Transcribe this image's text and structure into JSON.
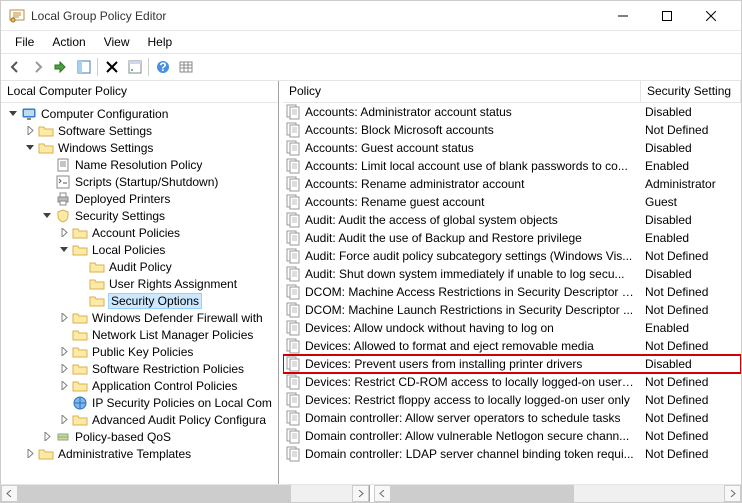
{
  "window": {
    "title": "Local Group Policy Editor"
  },
  "menu": [
    "File",
    "Action",
    "View",
    "Help"
  ],
  "leftHeader": "Local Computer Policy",
  "tree": [
    {
      "indent": 0,
      "twisty": "open",
      "icon": "computer",
      "label": "Computer Configuration",
      "sel": false
    },
    {
      "indent": 1,
      "twisty": "closed",
      "icon": "folder",
      "label": "Software Settings",
      "sel": false
    },
    {
      "indent": 1,
      "twisty": "open",
      "icon": "folder",
      "label": "Windows Settings",
      "sel": false
    },
    {
      "indent": 2,
      "twisty": "blank",
      "icon": "doc",
      "label": "Name Resolution Policy",
      "sel": false
    },
    {
      "indent": 2,
      "twisty": "blank",
      "icon": "script",
      "label": "Scripts (Startup/Shutdown)",
      "sel": false
    },
    {
      "indent": 2,
      "twisty": "blank",
      "icon": "printer",
      "label": "Deployed Printers",
      "sel": false
    },
    {
      "indent": 2,
      "twisty": "open",
      "icon": "shield",
      "label": "Security Settings",
      "sel": false
    },
    {
      "indent": 3,
      "twisty": "closed",
      "icon": "folder",
      "label": "Account Policies",
      "sel": false
    },
    {
      "indent": 3,
      "twisty": "open",
      "icon": "folder",
      "label": "Local Policies",
      "sel": false
    },
    {
      "indent": 4,
      "twisty": "blank",
      "icon": "folder",
      "label": "Audit Policy",
      "sel": false
    },
    {
      "indent": 4,
      "twisty": "blank",
      "icon": "folder",
      "label": "User Rights Assignment",
      "sel": false
    },
    {
      "indent": 4,
      "twisty": "blank",
      "icon": "folder",
      "label": "Security Options",
      "sel": true
    },
    {
      "indent": 3,
      "twisty": "closed",
      "icon": "folder",
      "label": "Windows Defender Firewall with",
      "sel": false
    },
    {
      "indent": 3,
      "twisty": "blank",
      "icon": "folder",
      "label": "Network List Manager Policies",
      "sel": false
    },
    {
      "indent": 3,
      "twisty": "closed",
      "icon": "folder",
      "label": "Public Key Policies",
      "sel": false
    },
    {
      "indent": 3,
      "twisty": "closed",
      "icon": "folder",
      "label": "Software Restriction Policies",
      "sel": false
    },
    {
      "indent": 3,
      "twisty": "closed",
      "icon": "folder",
      "label": "Application Control Policies",
      "sel": false
    },
    {
      "indent": 3,
      "twisty": "blank",
      "icon": "ipsec",
      "label": "IP Security Policies on Local Com",
      "sel": false
    },
    {
      "indent": 3,
      "twisty": "closed",
      "icon": "folder",
      "label": "Advanced Audit Policy Configura",
      "sel": false
    },
    {
      "indent": 2,
      "twisty": "closed",
      "icon": "qos",
      "label": "Policy-based QoS",
      "sel": false
    },
    {
      "indent": 1,
      "twisty": "closed",
      "icon": "folder",
      "label": "Administrative Templates",
      "sel": false
    }
  ],
  "columns": {
    "policy": "Policy",
    "setting": "Security Setting"
  },
  "rows": [
    {
      "policy": "Accounts: Administrator account status",
      "setting": "Disabled",
      "hl": false
    },
    {
      "policy": "Accounts: Block Microsoft accounts",
      "setting": "Not Defined",
      "hl": false
    },
    {
      "policy": "Accounts: Guest account status",
      "setting": "Disabled",
      "hl": false
    },
    {
      "policy": "Accounts: Limit local account use of blank passwords to co...",
      "setting": "Enabled",
      "hl": false
    },
    {
      "policy": "Accounts: Rename administrator account",
      "setting": "Administrator",
      "hl": false
    },
    {
      "policy": "Accounts: Rename guest account",
      "setting": "Guest",
      "hl": false
    },
    {
      "policy": "Audit: Audit the access of global system objects",
      "setting": "Disabled",
      "hl": false
    },
    {
      "policy": "Audit: Audit the use of Backup and Restore privilege",
      "setting": "Enabled",
      "hl": false
    },
    {
      "policy": "Audit: Force audit policy subcategory settings (Windows Vis...",
      "setting": "Not Defined",
      "hl": false
    },
    {
      "policy": "Audit: Shut down system immediately if unable to log secu...",
      "setting": "Disabled",
      "hl": false
    },
    {
      "policy": "DCOM: Machine Access Restrictions in Security Descriptor D...",
      "setting": "Not Defined",
      "hl": false
    },
    {
      "policy": "DCOM: Machine Launch Restrictions in Security Descriptor ...",
      "setting": "Not Defined",
      "hl": false
    },
    {
      "policy": "Devices: Allow undock without having to log on",
      "setting": "Enabled",
      "hl": false
    },
    {
      "policy": "Devices: Allowed to format and eject removable media",
      "setting": "Not Defined",
      "hl": false
    },
    {
      "policy": "Devices: Prevent users from installing printer drivers",
      "setting": "Disabled",
      "hl": true
    },
    {
      "policy": "Devices: Restrict CD-ROM access to locally logged-on user ...",
      "setting": "Not Defined",
      "hl": false
    },
    {
      "policy": "Devices: Restrict floppy access to locally logged-on user only",
      "setting": "Not Defined",
      "hl": false
    },
    {
      "policy": "Domain controller: Allow server operators to schedule tasks",
      "setting": "Not Defined",
      "hl": false
    },
    {
      "policy": "Domain controller: Allow vulnerable Netlogon secure chann...",
      "setting": "Not Defined",
      "hl": false
    },
    {
      "policy": "Domain controller: LDAP server channel binding token requi...",
      "setting": "Not Defined",
      "hl": false
    }
  ]
}
